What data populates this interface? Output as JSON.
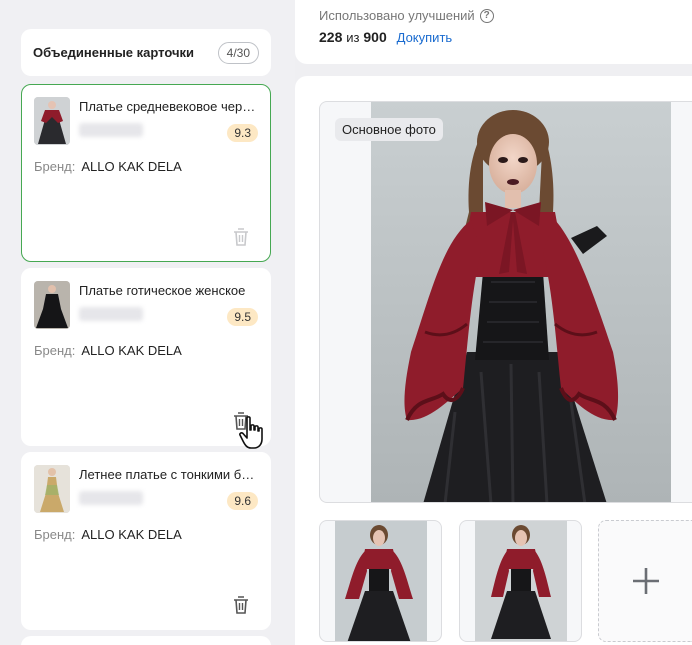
{
  "usage": {
    "label": "Использовано улучшений",
    "used": "228",
    "of": "из",
    "total": "900",
    "buy_more": "Докупить"
  },
  "merged": {
    "title": "Объединенные карточки",
    "count": "4/30"
  },
  "cards": [
    {
      "title": "Платье средневековое черное",
      "score": "9.3",
      "brand_label": "Бренд:",
      "brand": "ALLO KAK DELA"
    },
    {
      "title": "Платье готическое женское",
      "score": "9.5",
      "brand_label": "Бренд:",
      "brand": "ALLO KAK DELA"
    },
    {
      "title": "Летнее платье с тонкими бретелями",
      "score": "9.6",
      "brand_label": "Бренд:",
      "brand": "ALLO KAK DELA"
    }
  ],
  "main_photo": {
    "badge": "Основное фото"
  },
  "colors": {
    "accent_green": "#46a852",
    "link_blue": "#1a6bcf",
    "score_bg": "#fde8c4",
    "dress_red": "#8f1c2b"
  },
  "icons": {
    "trash": "trash-icon",
    "help": "help-circle-icon",
    "add": "plus-icon",
    "cursor": "hand-pointer-icon"
  }
}
